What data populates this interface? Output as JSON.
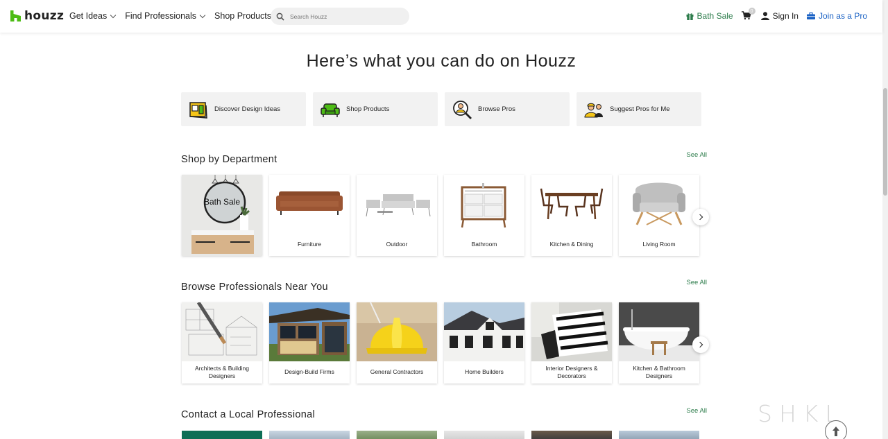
{
  "brand": {
    "name": "houzz",
    "color": "#4dbc15"
  },
  "nav": {
    "items": [
      {
        "label": "Get Ideas"
      },
      {
        "label": "Find Professionals"
      },
      {
        "label": "Shop Products"
      }
    ]
  },
  "search": {
    "placeholder": "Search Houzz"
  },
  "header_right": {
    "bath_sale": "Bath Sale",
    "cart_count": "0",
    "sign_in": "Sign In",
    "join_pro": "Join as a Pro"
  },
  "hero": {
    "title": "Here’s what you can do on Houzz"
  },
  "actions": [
    {
      "label": "Discover Design Ideas",
      "icon": "design-ideas-icon"
    },
    {
      "label": "Shop Products",
      "icon": "sofa-icon"
    },
    {
      "label": "Browse Pros",
      "icon": "magnifier-person-icon"
    },
    {
      "label": "Suggest Pros for Me",
      "icon": "pros-suggest-icon"
    }
  ],
  "shop_department": {
    "title": "Shop by Department",
    "see_all": "See All",
    "banner_text": "Bath Sale",
    "items": [
      {
        "label": "Furniture"
      },
      {
        "label": "Outdoor"
      },
      {
        "label": "Bathroom"
      },
      {
        "label": "Kitchen & Dining"
      },
      {
        "label": "Living Room"
      }
    ]
  },
  "browse_pros": {
    "title": "Browse Professionals Near You",
    "see_all": "See All",
    "items": [
      {
        "label": "Architects & Building Designers"
      },
      {
        "label": "Design-Build Firms"
      },
      {
        "label": "General Contractors"
      },
      {
        "label": "Home Builders"
      },
      {
        "label": "Interior Designers & Decorators"
      },
      {
        "label": "Kitchen & Bathroom Designers"
      }
    ]
  },
  "contact_local": {
    "title": "Contact a Local Professional",
    "see_all": "See All"
  },
  "watermark": "SHKL",
  "colors": {
    "green": "#2c7c4b",
    "blue": "#1b62c4",
    "action_bg": "#f2f2f2"
  }
}
